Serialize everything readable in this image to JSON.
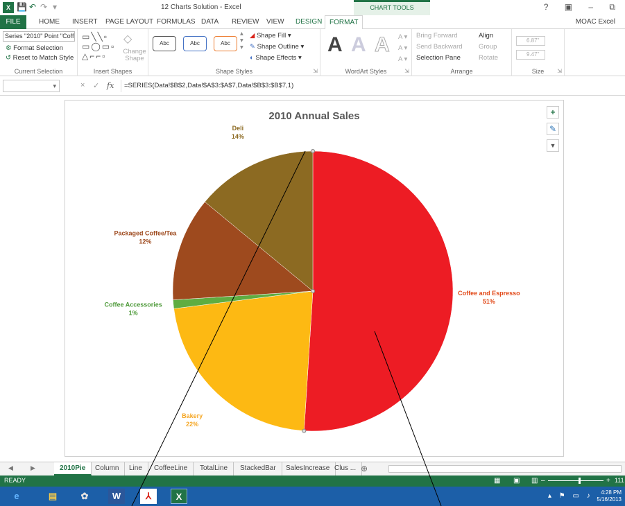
{
  "window": {
    "title": "12 Charts Solution - Excel",
    "chart_tools_label": "CHART TOOLS",
    "account": "MOAC Excel",
    "controls": "? ▣ – ⧉"
  },
  "qat": {
    "app_icon": "X",
    "save": "💾",
    "undo": "↶",
    "redo": "↷",
    "more": "▾"
  },
  "ribbon_tabs": [
    "HOME",
    "INSERT",
    "PAGE LAYOUT",
    "FORMULAS",
    "DATA",
    "REVIEW",
    "VIEW",
    "DESIGN",
    "FORMAT"
  ],
  "file_tab": "FILE",
  "ribbon": {
    "current_selection": {
      "selector_value": "Series \"2010\" Point \"Coff",
      "format_selection": "Format Selection",
      "reset_style": "Reset to Match Style",
      "label": "Current Selection"
    },
    "insert_shapes": {
      "change_shape": "Change Shape",
      "label": "Insert Shapes"
    },
    "shape_styles": {
      "style_sample": "Abc",
      "fill": "Shape Fill",
      "outline": "Shape Outline",
      "effects": "Shape Effects",
      "label": "Shape Styles"
    },
    "wordart": {
      "glyph": "A",
      "label": "WordArt Styles"
    },
    "arrange": {
      "bring_forward": "Bring Forward",
      "send_backward": "Send Backward",
      "selection_pane": "Selection Pane",
      "align": "Align",
      "group": "Group",
      "rotate": "Rotate",
      "label": "Arrange"
    },
    "size": {
      "height": "6.87\"",
      "width": "9.47\"",
      "label": "Size"
    }
  },
  "formula_bar": {
    "name_box": "▾",
    "cancel": "×",
    "enter": "✓",
    "fx": "fx",
    "formula": "=SERIES(Data!$B$2,Data!$A$3:$A$7,Data!$B$3:$B$7,1)"
  },
  "chart_tools": {
    "add": "+",
    "style": "✎",
    "filter": "▼"
  },
  "chart_data": {
    "type": "pie",
    "title": "2010 Annual Sales",
    "slices": [
      {
        "name": "Coffee and Espresso",
        "value": 51,
        "label": "51%",
        "color": "#ED1C24"
      },
      {
        "name": "Bakery",
        "value": 22,
        "label": "22%",
        "color": "#FDB913"
      },
      {
        "name": "Coffee Accessories",
        "value": 1,
        "label": "1%",
        "color": "#5FAD41"
      },
      {
        "name": "Packaged Coffee/Tea",
        "value": 12,
        "label": "12%",
        "color": "#9E4A1E"
      },
      {
        "name": "Deli",
        "value": 14,
        "label": "14%",
        "color": "#8C6A22"
      }
    ],
    "label_colors": {
      "Coffee and Espresso": "#E24A1A",
      "Bakery": "#F5A623",
      "Coffee Accessories": "#4E9A3A",
      "Packaged Coffee/Tea": "#9E4A1E",
      "Deli": "#8C6A22"
    },
    "legend": "none"
  },
  "sheet_tabs": {
    "nav_prev": "◀",
    "nav_next": "▶",
    "tabs": [
      "2010Pie",
      "Column",
      "Line",
      "CoffeeLine",
      "TotalLine",
      "StackedBar",
      "SalesIncrease",
      "Clus ..."
    ],
    "active": "2010Pie",
    "add": "⊕"
  },
  "status": {
    "text": "READY",
    "zoom": "111"
  },
  "taskbar": {
    "apps": [
      {
        "name": "ie",
        "glyph": "e",
        "color": "#63b4ff"
      },
      {
        "name": "explorer",
        "glyph": "▤",
        "color": "#f2c94c"
      },
      {
        "name": "paint",
        "glyph": "✿",
        "color": "#e0e0e0"
      },
      {
        "name": "word",
        "glyph": "W",
        "color": "#2b579a"
      },
      {
        "name": "acrobat",
        "glyph": "⅄",
        "color": "#d9261c"
      },
      {
        "name": "excel",
        "glyph": "X",
        "color": "#217346"
      }
    ],
    "time": "4:28 PM",
    "date": "5/16/2013"
  }
}
